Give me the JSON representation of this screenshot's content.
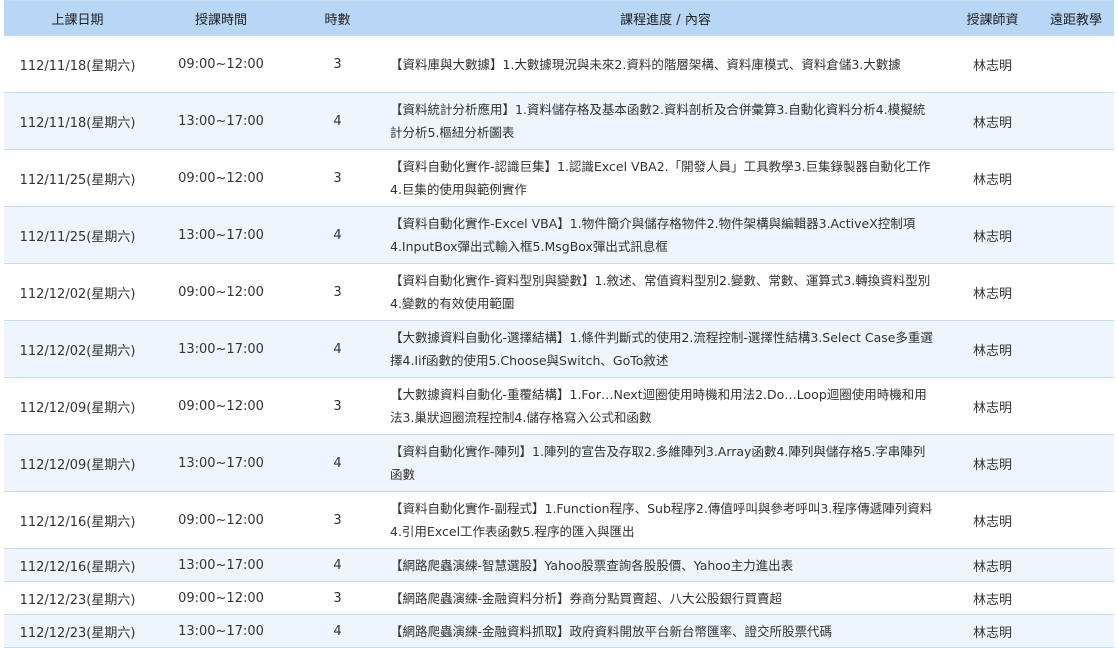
{
  "table": {
    "headers": {
      "date": "上課日期",
      "time": "授課時間",
      "hours": "時數",
      "content": "課程進度 / 內容",
      "teacher": "授課師資",
      "remote": "遠距教學"
    },
    "rows": [
      {
        "date": "112/11/18(星期六)",
        "time": "09:00~12:00",
        "hours": "3",
        "content": "【資料庫與大數據】1.大數據現況與未來2.資料的階層架構、資料庫模式、資料倉儲3.大數據",
        "teacher": "林志明",
        "remote": ""
      },
      {
        "date": "112/11/18(星期六)",
        "time": "13:00~17:00",
        "hours": "4",
        "content": "【資料統計分析應用】1.資料儲存格及基本函數2.資料剖析及合併彙算3.自動化資料分析4.模擬統計分析5.樞紐分析圖表",
        "teacher": "林志明",
        "remote": ""
      },
      {
        "date": "112/11/25(星期六)",
        "time": "09:00~12:00",
        "hours": "3",
        "content": "【資料自動化實作-認識巨集】1.認識Excel VBA2.「開發人員」工具教學3.巨集錄製器自動化工作4.巨集的使用與範例實作",
        "teacher": "林志明",
        "remote": ""
      },
      {
        "date": "112/11/25(星期六)",
        "time": "13:00~17:00",
        "hours": "4",
        "content": "【資料自動化實作-Excel VBA】1.物件簡介與儲存格物件2.物件架構與編輯器3.ActiveX控制項4.InputBox彈出式輸入框5.MsgBox彈出式訊息框",
        "teacher": "林志明",
        "remote": ""
      },
      {
        "date": "112/12/02(星期六)",
        "time": "09:00~12:00",
        "hours": "3",
        "content": "【資料自動化實作-資料型別與變數】1.敘述、常值資料型別2.變數、常數、運算式3.轉換資料型別4.變數的有效使用範圍",
        "teacher": "林志明",
        "remote": ""
      },
      {
        "date": "112/12/02(星期六)",
        "time": "13:00~17:00",
        "hours": "4",
        "content": "【大數據資料自動化-選擇結構】1.條件判斷式的使用2.流程控制-選擇性結構3.Select Case多重選擇4.Iif函數的使用5.Choose與Switch、GoTo敘述",
        "teacher": "林志明",
        "remote": ""
      },
      {
        "date": "112/12/09(星期六)",
        "time": "09:00~12:00",
        "hours": "3",
        "content": "【大數據資料自動化-重覆結構】1.For…Next迴圈使用時機和用法2.Do…Loop迴圈使用時機和用法3.巢狀迴圈流程控制4.儲存格寫入公式和函數",
        "teacher": "林志明",
        "remote": ""
      },
      {
        "date": "112/12/09(星期六)",
        "time": "13:00~17:00",
        "hours": "4",
        "content": "【資料自動化實作-陣列】1.陣列的宣告及存取2.多維陣列3.Array函數4.陣列與儲存格5.字串陣列函數",
        "teacher": "林志明",
        "remote": ""
      },
      {
        "date": "112/12/16(星期六)",
        "time": "09:00~12:00",
        "hours": "3",
        "content": "【資料自動化實作-副程式】1.Function程序、Sub程序2.傳值呼叫與參考呼叫3.程序傳遞陣列資料4.引用Excel工作表函數5.程序的匯入與匯出",
        "teacher": "林志明",
        "remote": ""
      },
      {
        "date": "112/12/16(星期六)",
        "time": "13:00~17:00",
        "hours": "4",
        "content": "【網路爬蟲演練-智慧選股】Yahoo股票查詢各股股價、Yahoo主力進出表",
        "teacher": "林志明",
        "remote": ""
      },
      {
        "date": "112/12/23(星期六)",
        "time": "09:00~12:00",
        "hours": "3",
        "content": "【網路爬蟲演練-金融資料分析】券商分點買賣超、八大公股銀行買賣超",
        "teacher": "林志明",
        "remote": ""
      },
      {
        "date": "112/12/23(星期六)",
        "time": "13:00~17:00",
        "hours": "4",
        "content": "【網路爬蟲演練-金融資料抓取】政府資料開放平台新台幣匯率、證交所股票代碼",
        "teacher": "林志明",
        "remote": ""
      }
    ]
  }
}
